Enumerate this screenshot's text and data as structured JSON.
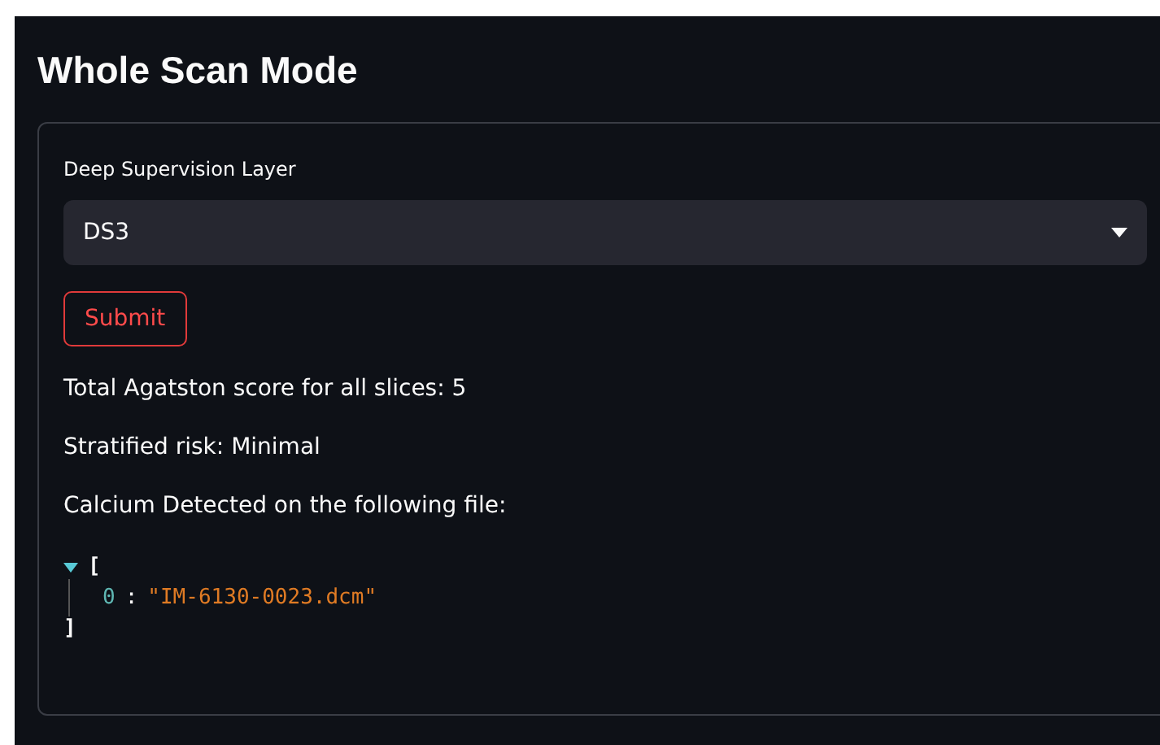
{
  "title": "Whole Scan Mode",
  "form": {
    "select": {
      "label": "Deep Supervision Layer",
      "value": "DS3"
    },
    "submit_button": "Submit"
  },
  "results": [
    "Total Agatston score for all slices: 5",
    "Stratified risk: Minimal",
    "Calcium Detected on the following file:"
  ],
  "json_viewer": {
    "expanded": true,
    "open_bracket": "[",
    "close_bracket": "]",
    "items": [
      {
        "index": "0",
        "separator": ":",
        "value": "\"IM-6130-0023.dcm\""
      }
    ]
  }
}
